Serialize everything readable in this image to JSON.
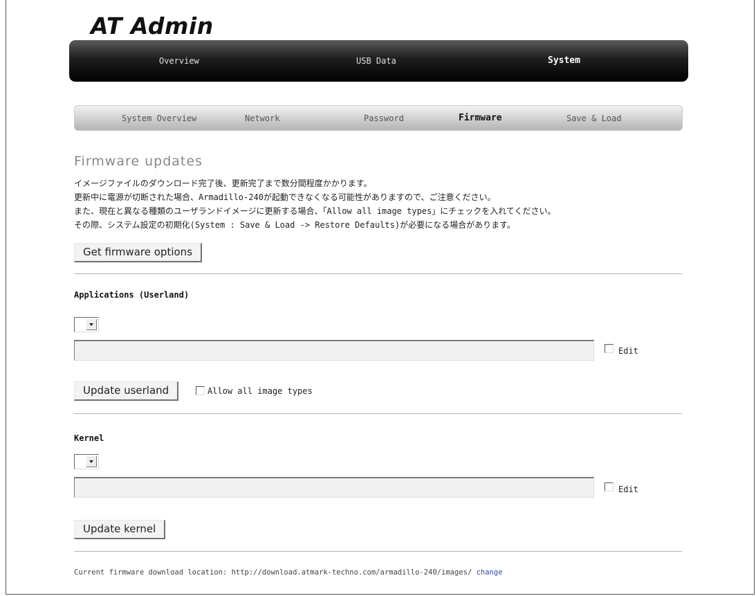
{
  "app": {
    "title": "AT Admin"
  },
  "main_nav": {
    "items": [
      {
        "label": "Overview"
      },
      {
        "label": "USB Data"
      },
      {
        "label": "System"
      }
    ],
    "active": "System"
  },
  "sub_nav": {
    "items": [
      {
        "label": "System Overview"
      },
      {
        "label": "Network"
      },
      {
        "label": "Password"
      },
      {
        "label": "Firmware"
      },
      {
        "label": "Save & Load"
      }
    ],
    "active": "Firmware"
  },
  "page": {
    "heading": "Firmware updates",
    "description": [
      "イメージファイルのダウンロード完了後、更新完了まで数分間程度かかります。",
      "更新中に電源が切断された場合、Armadillo-240が起動できなくなる可能性がありますので、ご注意ください。",
      "また、現在と異なる種類のユーザランドイメージに更新する場合、「Allow all image types」にチェックを入れてください。",
      "その際、システム設定の初期化(System : Save & Load -> Restore Defaults)が必要になる場合があります。"
    ],
    "get_options_button": "Get firmware options"
  },
  "userland": {
    "title": "Applications (Userland)",
    "select_value": "",
    "field_value": "",
    "edit_label": "Edit",
    "edit_checked": false,
    "update_button": "Update userland",
    "allow_all_label": "Allow all image types",
    "allow_all_checked": false
  },
  "kernel": {
    "title": "Kernel",
    "select_value": "",
    "field_value": "",
    "edit_label": "Edit",
    "edit_checked": false,
    "update_button": "Update kernel"
  },
  "footer": {
    "label": "Current firmware download location: http://download.atmark-techno.com/armadillo-240/images/",
    "link": "change"
  }
}
